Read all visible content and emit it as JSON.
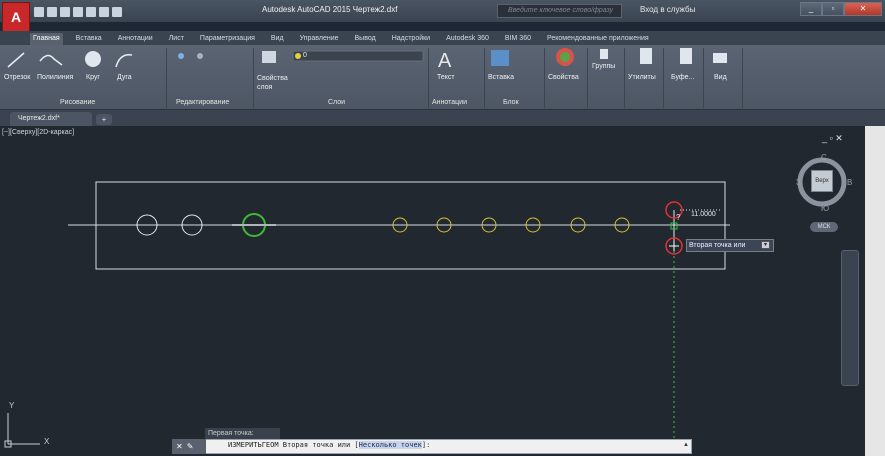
{
  "title_bar": {
    "app_button": "A",
    "title": "Autodesk AutoCAD 2015    Чертеж2.dxf",
    "search_placeholder": "Введите ключевое слово/фразу",
    "sign_in": "Вход в службы"
  },
  "ribbon_tabs": [
    "Главная",
    "Вставка",
    "Аннотации",
    "Лист",
    "Параметризация",
    "Вид",
    "Управление",
    "Вывод",
    "Надстройки",
    "Autodesk 360",
    "BIM 360",
    "Рекомендованные приложения"
  ],
  "ribbon": {
    "draw_tools": [
      "Отрезок",
      "Полилиния",
      "Круг",
      "Дуга"
    ],
    "layer_props_label": "Свойства слоя",
    "layer_value": "0",
    "text_label": "Текст",
    "insert_label": "Вставка",
    "properties_label": "Свойства",
    "groups_label": "Группы",
    "utilities_label": "Утилиты",
    "clipboard_label": "Буфе...",
    "view_label": "Вид",
    "groups": [
      "Рисование",
      "Редактирование",
      "Слои",
      "Аннотации",
      "Блок"
    ]
  },
  "file_tab": {
    "name": "Чертеж2.dxf*",
    "new_tab": "+"
  },
  "viewport": {
    "controls": "[−][Сверху][2D-каркас]",
    "window_controls": "_ ▫ ✕",
    "viewcube": {
      "north": "С",
      "south": "Ю",
      "west": "З",
      "east": "В",
      "face": "Верх",
      "wcs": "МСК"
    },
    "ucs_y": "Y",
    "ucs_x": "X"
  },
  "measure": {
    "dimension_text": "11.0000",
    "tooltip": "Вторая точка или"
  },
  "command": {
    "history": "Первая точка:",
    "command_name": "ИЗМЕРИТЬГЕОМ",
    "prompt": " Вторая точка или [",
    "option": "Несколько точек",
    "suffix": "]:"
  },
  "colors": {
    "canvas": "#212830",
    "yellow_circles": "#d6c233",
    "green_circle": "#3dbb34",
    "red_marker": "#e03333"
  }
}
